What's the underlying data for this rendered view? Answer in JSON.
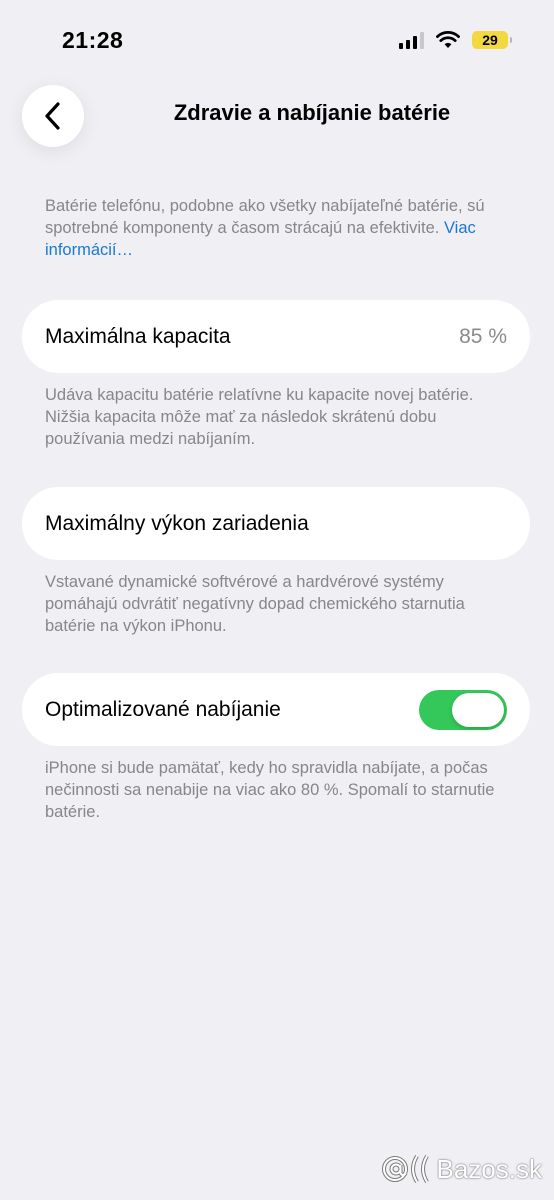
{
  "status_bar": {
    "time": "21:28",
    "battery_level": "29",
    "signal_bars_active": 3,
    "signal_bars_total": 4
  },
  "nav": {
    "title": "Zdravie a nabíjanie batérie"
  },
  "intro": {
    "text": "Batérie telefónu, podobne ako všetky nabíjateľné batérie, sú spotrebné komponenty a časom strácajú na efektivite. ",
    "link": "Viac informácií…"
  },
  "max_capacity": {
    "label": "Maximálna kapacita",
    "value": "85 %",
    "footnote": "Udáva kapacitu batérie relatívne ku kapacite novej batérie. Nižšia kapacita môže mať za následok skrátenú dobu používania medzi nabíjaním."
  },
  "peak_performance": {
    "label": "Maximálny výkon zariadenia",
    "footnote": "Vstavané dynamické softvérové a hardvérové systémy pomáhajú odvrátiť negatívny dopad chemického starnutia batérie na výkon iPhonu."
  },
  "optimized_charging": {
    "label": "Optimalizované nabíjanie",
    "enabled": true,
    "footnote": "iPhone si bude pamätať, kedy ho spravidla nabíjate, a počas nečinnosti sa nenabije na viac ako 80 %. Spomalí to starnutie batérie."
  },
  "watermark": {
    "text": "Bazos.sk"
  },
  "colors": {
    "background": "#efeff4",
    "toggle_on": "#34c759",
    "link": "#1a78d2",
    "battery": "#f3d83f"
  },
  "icons": [
    "chevron-left-icon",
    "cellular-signal-icon",
    "wifi-icon",
    "battery-icon"
  ]
}
